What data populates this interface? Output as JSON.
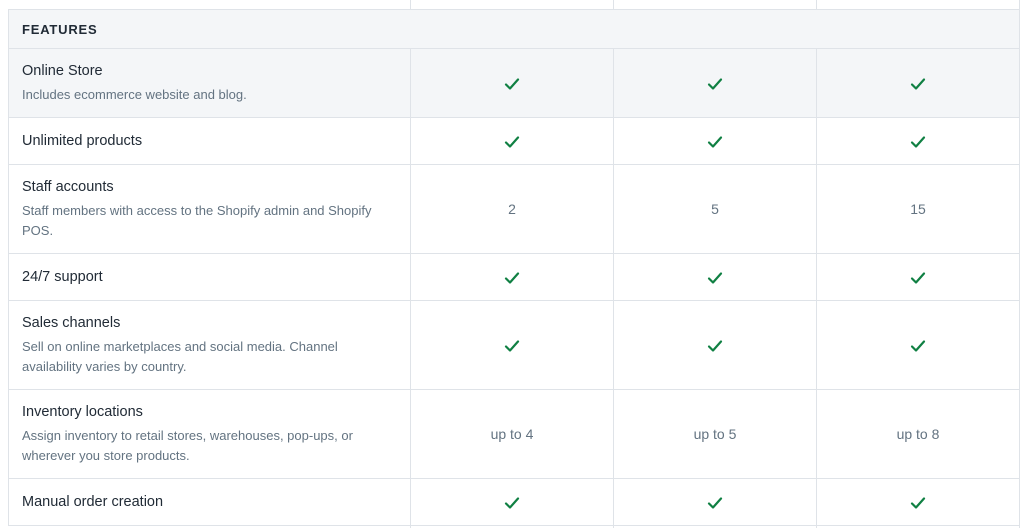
{
  "section": {
    "title": "FEATURES"
  },
  "colors": {
    "check": "#108043",
    "header_bg": "#f4f6f8",
    "border": "#dfe3e8",
    "muted_text": "#637381"
  },
  "rows": [
    {
      "name": "Online Store",
      "description": "Includes ecommerce website and blog.",
      "values": [
        "check",
        "check",
        "check"
      ]
    },
    {
      "name": "Unlimited products",
      "description": "",
      "values": [
        "check",
        "check",
        "check"
      ]
    },
    {
      "name": "Staff accounts",
      "description": "Staff members with access to the Shopify admin and Shopify POS.",
      "values": [
        "2",
        "5",
        "15"
      ]
    },
    {
      "name": "24/7 support",
      "description": "",
      "values": [
        "check",
        "check",
        "check"
      ]
    },
    {
      "name": "Sales channels",
      "description": "Sell on online marketplaces and social media. Channel availability varies by country.",
      "values": [
        "check",
        "check",
        "check"
      ]
    },
    {
      "name": "Inventory locations",
      "description": "Assign inventory to retail stores, warehouses, pop-ups, or wherever you store products.",
      "values": [
        "up to 4",
        "up to 5",
        "up to 8"
      ]
    },
    {
      "name": "Manual order creation",
      "description": "",
      "values": [
        "check",
        "check",
        "check"
      ]
    }
  ],
  "icons": {
    "included": "checkmark-icon"
  }
}
